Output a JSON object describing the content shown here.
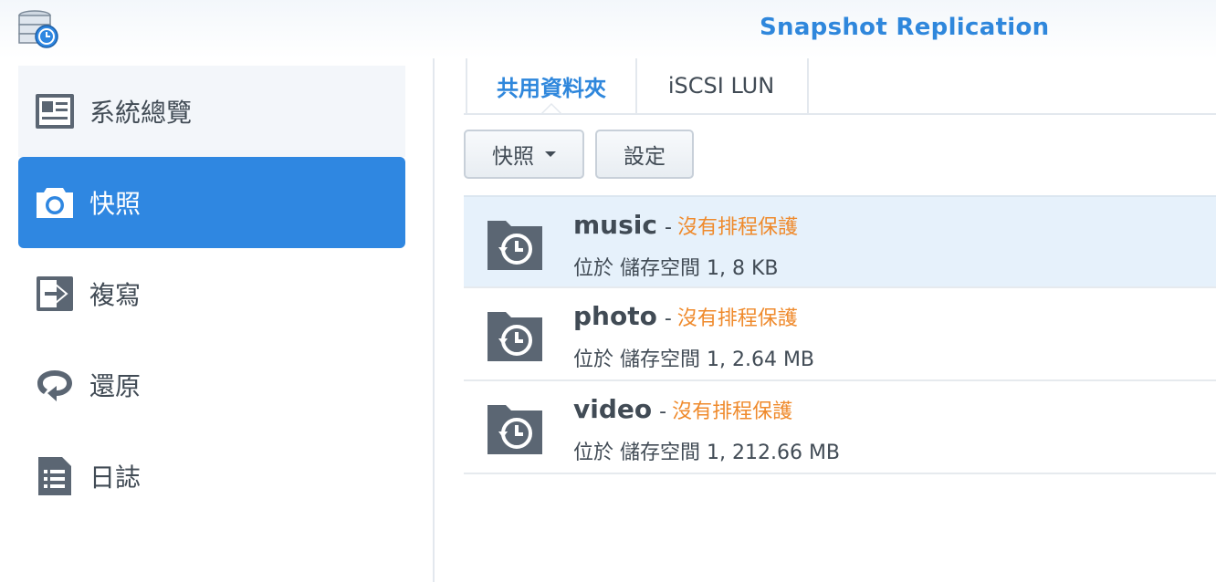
{
  "app": {
    "title": "Snapshot Replication",
    "icon": "snapshot-replication-app-icon"
  },
  "sidebar": {
    "items": [
      {
        "label": "系統總覽",
        "icon": "overview-card-icon",
        "active": false
      },
      {
        "label": "快照",
        "icon": "camera-icon",
        "active": true
      },
      {
        "label": "複寫",
        "icon": "replication-arrow-icon",
        "active": false
      },
      {
        "label": "還原",
        "icon": "restore-loop-icon",
        "active": false
      },
      {
        "label": "日誌",
        "icon": "log-document-icon",
        "active": false
      }
    ]
  },
  "tabs": [
    {
      "label": "共用資料夾",
      "active": true
    },
    {
      "label": "iSCSI LUN",
      "active": false
    }
  ],
  "toolbar": {
    "snapshot_label": "快照",
    "settings_label": "設定"
  },
  "folders": [
    {
      "name": "music",
      "separator": "-",
      "status": "沒有排程保護",
      "location": "位於 儲存空間 1, 8 KB",
      "selected": true
    },
    {
      "name": "photo",
      "separator": "-",
      "status": "沒有排程保護",
      "location": "位於 儲存空間 1, 2.64 MB",
      "selected": false
    },
    {
      "name": "video",
      "separator": "-",
      "status": "沒有排程保護",
      "location": "位於 儲存空間 1, 212.66 MB",
      "selected": false
    }
  ],
  "colors": {
    "accent": "#2f87e1",
    "warning": "#ef8a2c",
    "text": "#414b55",
    "selected_row": "#e6f1fb"
  }
}
